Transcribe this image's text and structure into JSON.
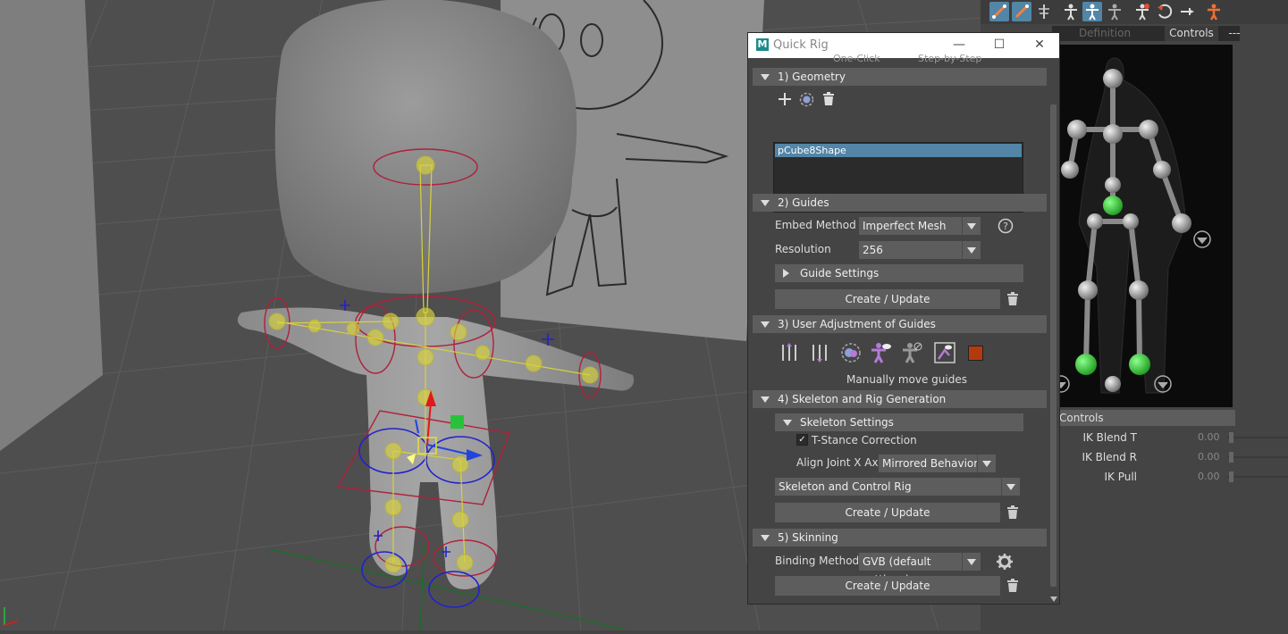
{
  "hik": {
    "tabs": [
      "Definition",
      "Controls",
      "---"
    ],
    "controls_header": "Controls",
    "ik_rows": [
      {
        "label": "IK Blend T",
        "value": "0.00"
      },
      {
        "label": "IK Blend R",
        "value": "0.00"
      },
      {
        "label": "IK Pull",
        "value": "0.00"
      }
    ]
  },
  "quick_rig": {
    "title": "Quick Rig",
    "clipped_options": [
      "One-Click",
      "Step-by-Step"
    ],
    "geometry": {
      "header": "1) Geometry",
      "items": [
        "pCube8Shape"
      ]
    },
    "guides": {
      "header": "2) Guides",
      "embed_label": "Embed Method",
      "embed_value": "Imperfect Mesh",
      "resolution_label": "Resolution",
      "resolution_value": "256",
      "settings_label": "Guide Settings",
      "create_label": "Create / Update"
    },
    "adjust": {
      "header": "3) User Adjustment of Guides",
      "caption": "Manually move guides",
      "swatch_color": "#b33a0c"
    },
    "skeleton": {
      "header": "4) Skeleton and Rig Generation",
      "settings_label": "Skeleton Settings",
      "tstance_label": "T-Stance Correction",
      "tstance_checked": true,
      "align_label": "Align Joint X Axis",
      "align_value": "Mirrored Behavior",
      "rig_value": "Skeleton and Control Rig",
      "create_label": "Create / Update"
    },
    "skinning": {
      "header": "5) Skinning",
      "binding_label": "Binding Method",
      "binding_value": "GVB (default settings)",
      "create_label": "Create / Update"
    }
  },
  "colors": {
    "accent": "#5285a6",
    "panel": "#444444",
    "header": "#5d5d5d",
    "guide_yellow": "#d8d23a",
    "selected_green": "#3ddc3d"
  }
}
